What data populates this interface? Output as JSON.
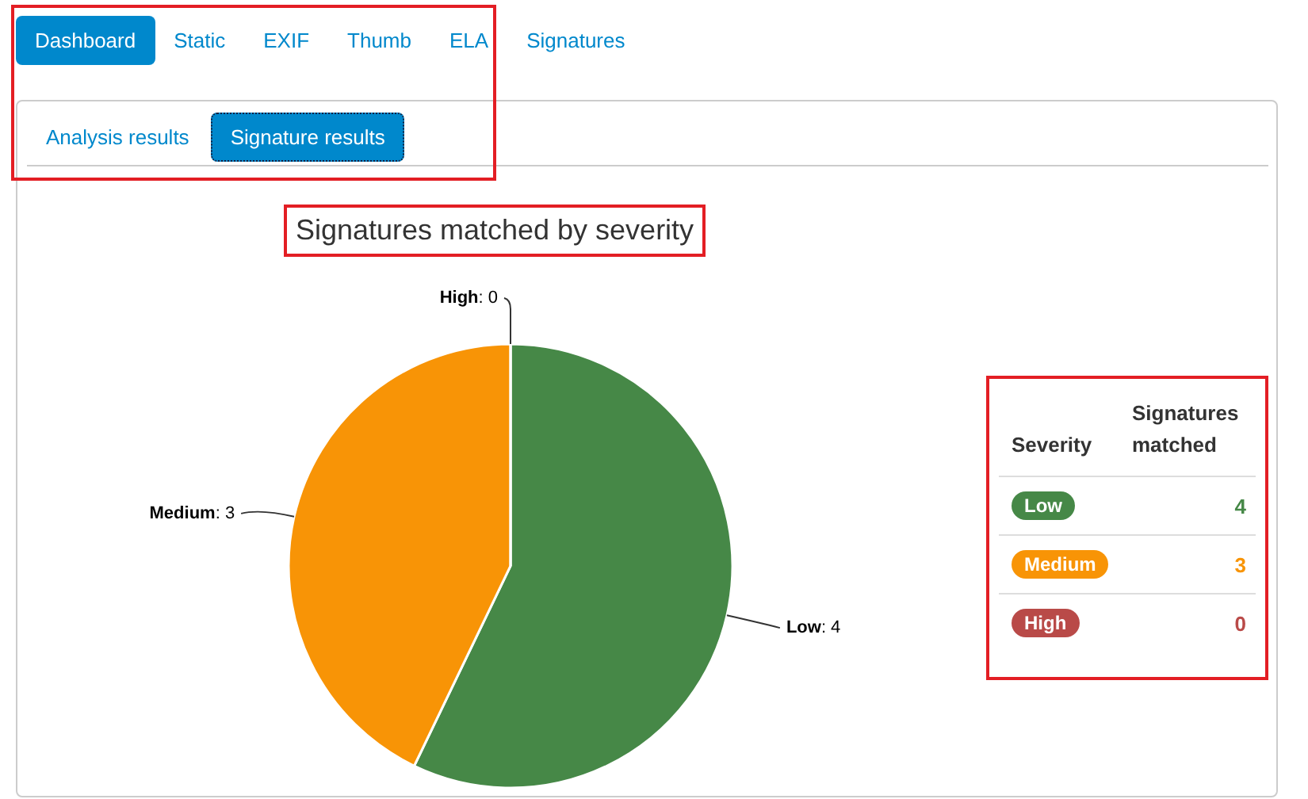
{
  "main_tabs": [
    {
      "label": "Dashboard",
      "selected": true
    },
    {
      "label": "Static",
      "selected": false
    },
    {
      "label": "EXIF",
      "selected": false
    },
    {
      "label": "Thumb",
      "selected": false
    },
    {
      "label": "ELA",
      "selected": false
    },
    {
      "label": "Signatures",
      "selected": false
    }
  ],
  "sub_tabs": [
    {
      "label": "Analysis results",
      "selected": false
    },
    {
      "label": "Signature results",
      "selected": true
    }
  ],
  "chart": {
    "chart_data": {
      "type": "pie",
      "title": "Signatures matched by severity",
      "categories": [
        "Low",
        "Medium",
        "High"
      ],
      "values": [
        4,
        3,
        0
      ],
      "colors": [
        "#468847",
        "#f89406",
        "#b94a48"
      ],
      "value_labels": [
        ": 4",
        ": 3",
        ": 0"
      ]
    }
  },
  "table": {
    "columns": [
      "Severity",
      "Signatures matched"
    ],
    "rows": [
      {
        "severity": "Low",
        "count": "4",
        "color": "#468847"
      },
      {
        "severity": "Medium",
        "count": "3",
        "color": "#f89406"
      },
      {
        "severity": "High",
        "count": "0",
        "color": "#b94a48"
      }
    ]
  }
}
